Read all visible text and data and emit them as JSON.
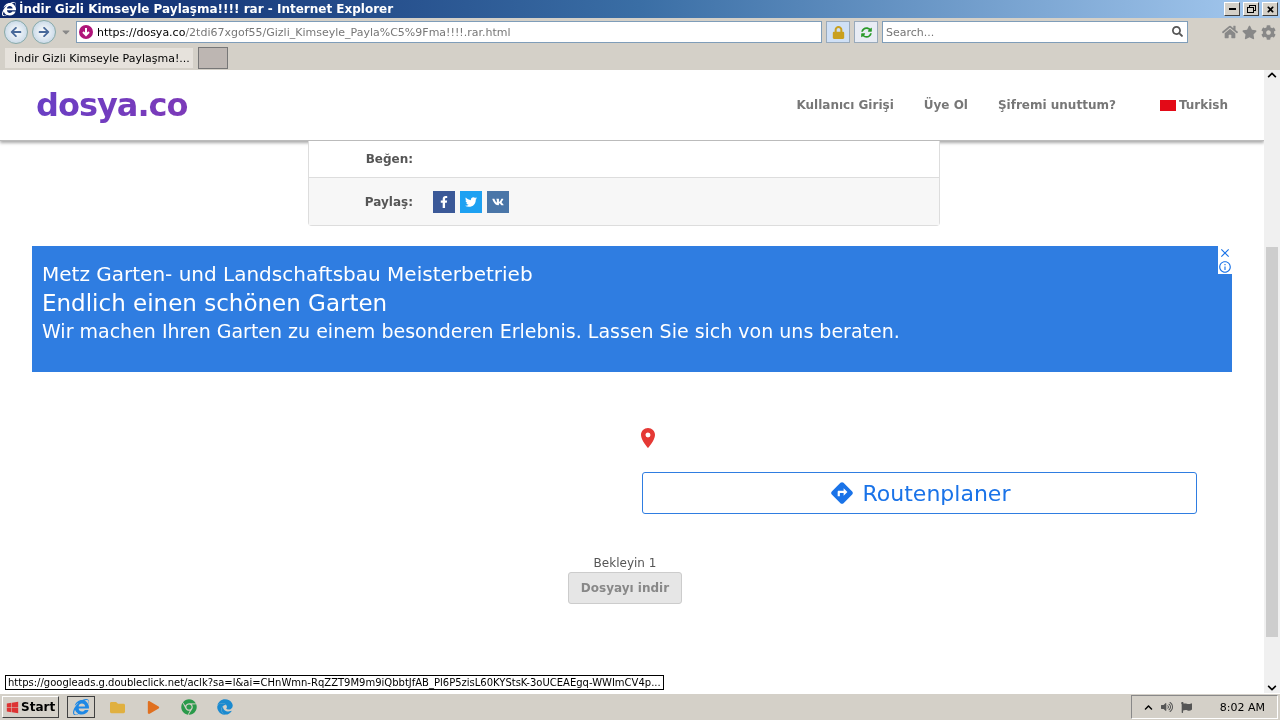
{
  "window": {
    "title": "İndir Gizli Kimseyle Paylaşma!!!! rar - Internet Explorer"
  },
  "address": {
    "host": "https://dosya.co",
    "path": "/2tdi67xgof55/Gizli_Kimseyle_Payla%C5%9Fma!!!!.rar.html"
  },
  "search": {
    "placeholder": "Search..."
  },
  "tabs": [
    {
      "label": "İndir Gizli Kimseyle Paylaşma!...",
      "selected": true
    }
  ],
  "site": {
    "logo": "dosya.co",
    "nav": [
      "Kullanıcı Girişi",
      "Üye Ol",
      "Şifremi unuttum?"
    ],
    "language": "Turkish"
  },
  "file_info": [
    {
      "kind": "empty",
      "label": "Beğen:"
    },
    {
      "kind": "share",
      "label": "Paylaş:"
    }
  ],
  "ad": {
    "advertiser": "Metz Garten- und Landschaftsbau Meisterbetrieb",
    "headline": "Endlich einen schönen Garten",
    "body": "Wir machen Ihren Garten zu einem besonderen Erlebnis. Lassen Sie sich von uns beraten.",
    "route_button": "Routenplaner"
  },
  "download": {
    "wait_text": "Bekleyin 1",
    "button": {
      "label": "Dosyayı indir",
      "disabled": true
    }
  },
  "status_url": "https://googleads.g.doubleclick.net/aclk?sa=l&ai=CHnWmn-RqZZT9M9m9iQbbtJfAB_Pl6P5zisL60KYStsK-3oUCEAEgq-WWImCV4p...",
  "taskbar": {
    "start": "Start",
    "clock": "8:02 AM"
  }
}
